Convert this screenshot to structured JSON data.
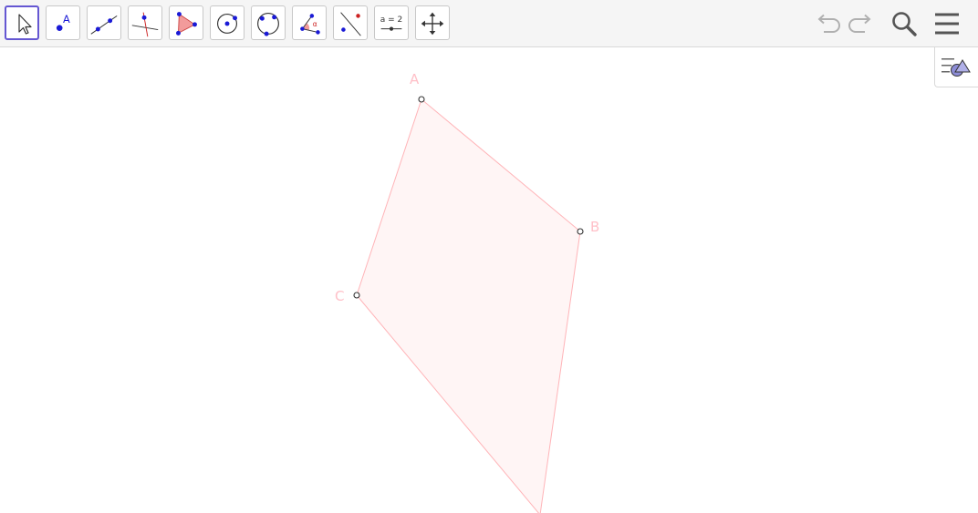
{
  "toolbar": {
    "tools": [
      {
        "id": "move",
        "icon": "move-arrow-icon",
        "selected": true
      },
      {
        "id": "point",
        "icon": "point-icon",
        "selected": false,
        "glyph": "A"
      },
      {
        "id": "line",
        "icon": "line-icon",
        "selected": false
      },
      {
        "id": "perpendicular",
        "icon": "perpendicular-line-icon",
        "selected": false
      },
      {
        "id": "polygon",
        "icon": "polygon-icon",
        "selected": false
      },
      {
        "id": "circle",
        "icon": "circle-center-point-icon",
        "selected": false
      },
      {
        "id": "circle-3pts",
        "icon": "circle-three-points-icon",
        "selected": false
      },
      {
        "id": "angle",
        "icon": "angle-icon",
        "selected": false,
        "glyph": "α"
      },
      {
        "id": "reflect",
        "icon": "reflect-icon",
        "selected": false
      },
      {
        "id": "slider",
        "icon": "slider-icon",
        "selected": false,
        "glyph": "a = 2"
      },
      {
        "id": "move-view",
        "icon": "move-graphics-view-icon",
        "selected": false
      }
    ],
    "undo_icon": "undo-icon",
    "redo_icon": "redo-icon",
    "search_icon": "search-icon",
    "menu_icon": "menu-icon"
  },
  "side_panel_toggle_icon": "algebra-view-toggle-icon",
  "colors": {
    "accent": "#6557d2",
    "polygon_fill": "#fff5f5",
    "polygon_stroke": "#ffb4b8",
    "label_color": "#ffc0c8",
    "point_stroke": "#333333",
    "tool_blue": "#1a1ad6",
    "disabled": "#b0b0b0",
    "dark_icon": "#555555"
  },
  "construction": {
    "points": [
      {
        "label": "A"
      },
      {
        "label": "B"
      },
      {
        "label": "C"
      }
    ]
  }
}
